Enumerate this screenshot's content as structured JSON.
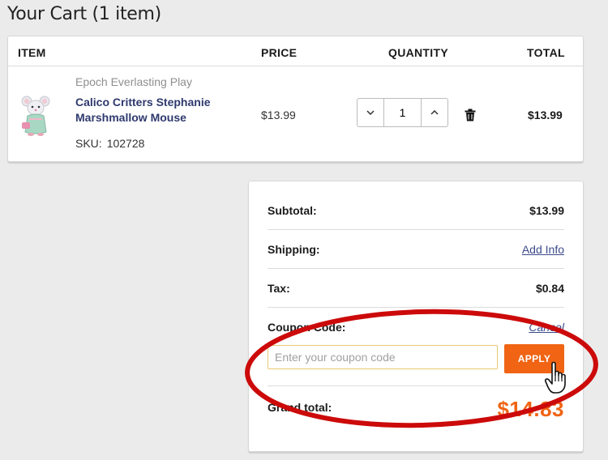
{
  "cart": {
    "title": "Your Cart (1 item)",
    "headers": {
      "item": "ITEM",
      "price": "PRICE",
      "quantity": "QUANTITY",
      "total": "TOTAL"
    },
    "items": [
      {
        "brand": "Epoch Everlasting Play",
        "name": "Calico Critters Stephanie Marshmallow Mouse",
        "sku_label": "SKU:",
        "sku": "102728",
        "price": "$13.99",
        "quantity": "1",
        "total": "$13.99"
      }
    ]
  },
  "summary": {
    "subtotal_label": "Subtotal:",
    "subtotal": "$13.99",
    "shipping_label": "Shipping:",
    "shipping_link": "Add Info",
    "tax_label": "Tax:",
    "tax": "$0.84",
    "coupon_label": "Coupon Code:",
    "coupon_cancel": "Cancel",
    "coupon_placeholder": "Enter your coupon code",
    "apply_label": "APPLY",
    "grand_total_label": "Grand total:",
    "grand_total": "$14.83"
  },
  "colors": {
    "accent": "#f06414",
    "link": "#3b4a8a",
    "annotation": "#cc0a0a"
  },
  "icons": [
    "chevron-down-icon",
    "chevron-up-icon",
    "trash-icon",
    "hand-cursor-icon"
  ]
}
